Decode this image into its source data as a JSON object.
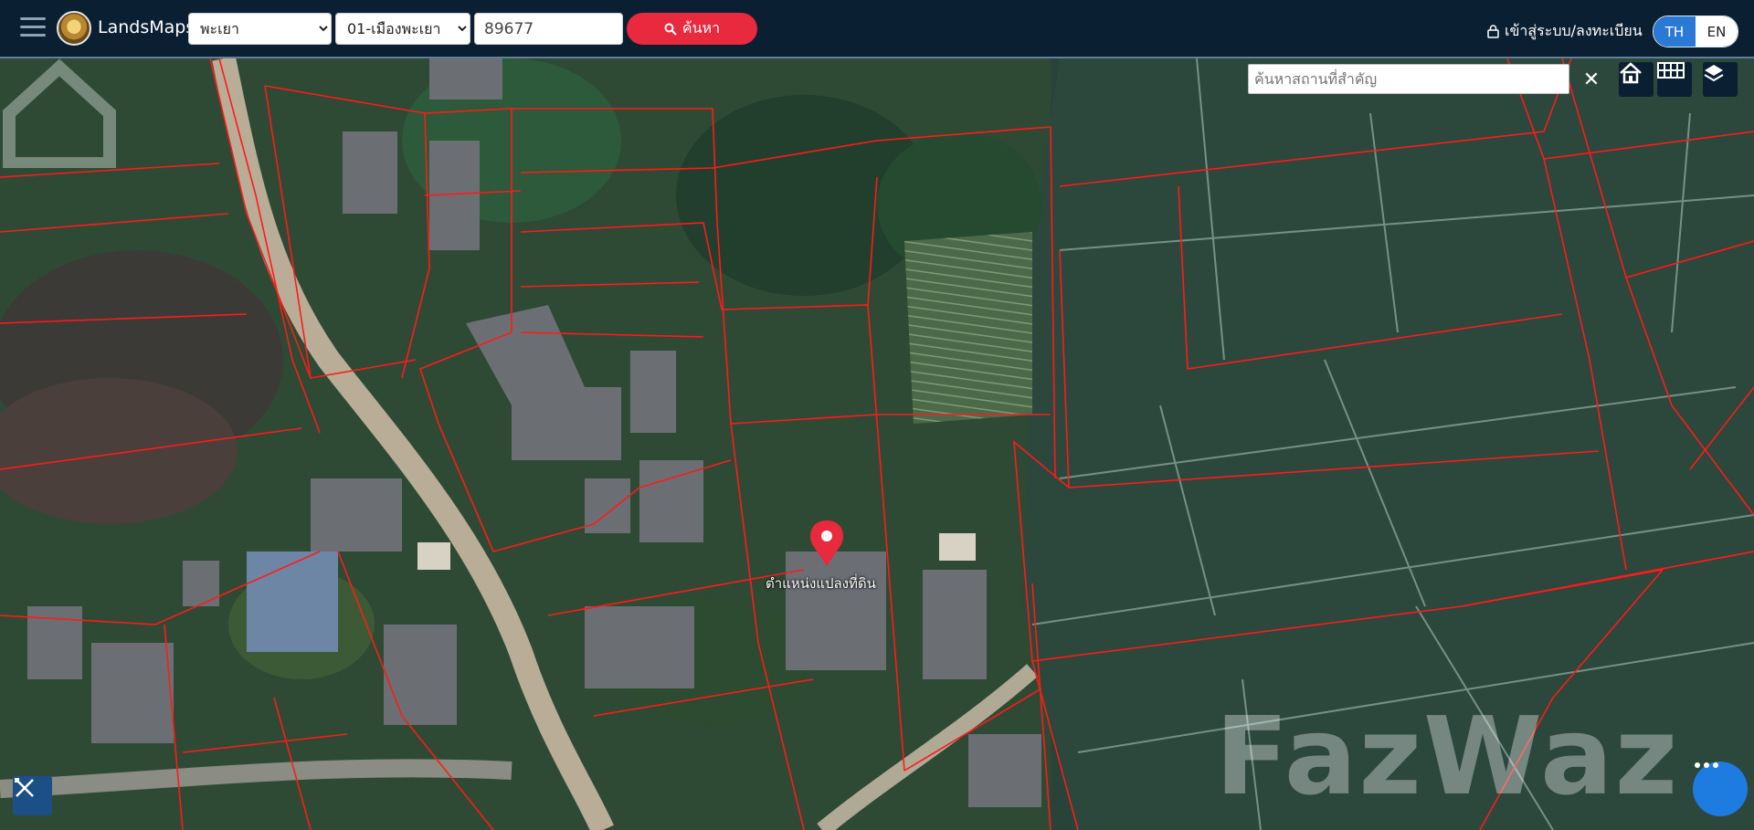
{
  "header": {
    "brand": "LandsMaps",
    "province_value": "พะเยา",
    "district_value": "01-เมืองพะเยา",
    "parcel_number": "89677",
    "search_label": "ค้นหา",
    "login_label": "เข้าสู่ระบบ/ลงทะเบียน",
    "lang_th": "TH",
    "lang_en": "EN"
  },
  "map": {
    "place_search_placeholder": "ค้นหาสถานที่สำคัญ",
    "clear_symbol": "✕",
    "marker_label": "ตำแหน่งแปลงที่ดิน",
    "watermark": "FazWaz",
    "parcel_line_color": "#ff1a1a",
    "marker_color": "#e8293e"
  }
}
